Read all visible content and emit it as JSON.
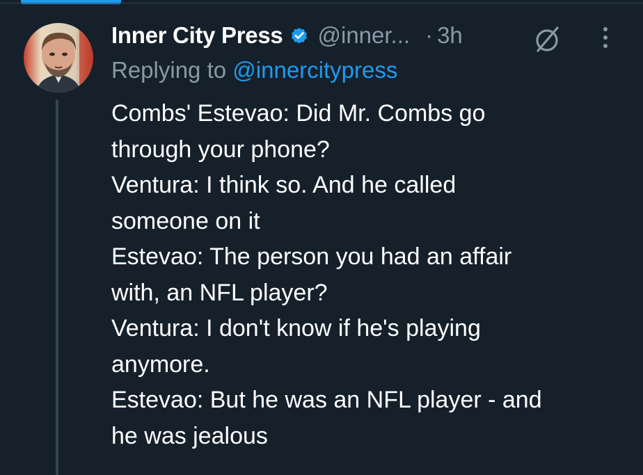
{
  "tweet": {
    "display_name": "Inner City Press",
    "handle": "@inner...",
    "separator": "·",
    "time": "3h",
    "replying_prefix": "Replying to",
    "replying_handle": "@innercitypress",
    "lines": [
      "Combs' Estevao: Did Mr. Combs go",
      "through your phone?",
      "Ventura: I think so. And he called",
      "someone on it",
      "Estevao: The person you had an affair",
      "with, an NFL player?",
      "Ventura: I don't know if he's playing",
      "anymore.",
      "Estevao: But he was an NFL player - and",
      "he was jealous"
    ]
  },
  "icons": {
    "verified": "verified-badge-icon",
    "grok": "grok-icon",
    "more": "more-options-icon"
  },
  "colors": {
    "background": "#15202b",
    "text": "#ffffff",
    "secondary_text": "#8b98a5",
    "accent": "#1d9bf0",
    "thread_line": "#38444d"
  }
}
